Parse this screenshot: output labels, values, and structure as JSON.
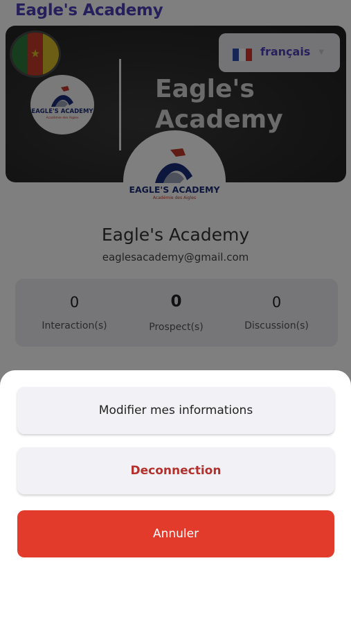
{
  "app": {
    "title": "Eagle's Academy"
  },
  "cover": {
    "name": "Eagle's Academy"
  },
  "language": {
    "selected": "français"
  },
  "logo": {
    "text": "EAGLE'S ACADEMY",
    "subtext": "Académie des Aigles"
  },
  "profile": {
    "name": "Eagle's Academy",
    "email": "eaglesacademy@gmail.com"
  },
  "stats": [
    {
      "value": "0",
      "label": "Interaction(s)"
    },
    {
      "value": "0",
      "label": "Prospect(s)"
    },
    {
      "value": "0",
      "label": "Discussion(s)"
    }
  ],
  "sheet": {
    "edit_label": "Modifier mes informations",
    "logout_label": "Deconnection",
    "cancel_label": "Annuler"
  },
  "colors": {
    "accent": "#4a3fb8",
    "danger": "#e23b2b",
    "danger_text": "#b4302c"
  },
  "icons": {
    "country_flag": "cameroon-flag-icon",
    "language_flag": "france-flag-icon",
    "dropdown": "chevron-down-icon"
  }
}
